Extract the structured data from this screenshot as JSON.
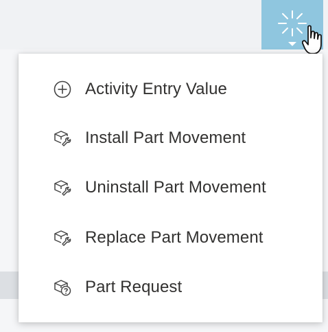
{
  "menu": {
    "items": [
      {
        "label": "Activity Entry Value",
        "icon": "add-circle-icon"
      },
      {
        "label": "Install Part Movement",
        "icon": "part-wrench-icon"
      },
      {
        "label": "Uninstall Part Movement",
        "icon": "part-wrench-icon"
      },
      {
        "label": "Replace Part Movement",
        "icon": "part-wrench-icon"
      },
      {
        "label": "Part Request",
        "icon": "part-request-icon"
      }
    ]
  },
  "toolbar": {
    "actions_icon": "sparkle-icon",
    "accent_color": "#8fc6df"
  }
}
